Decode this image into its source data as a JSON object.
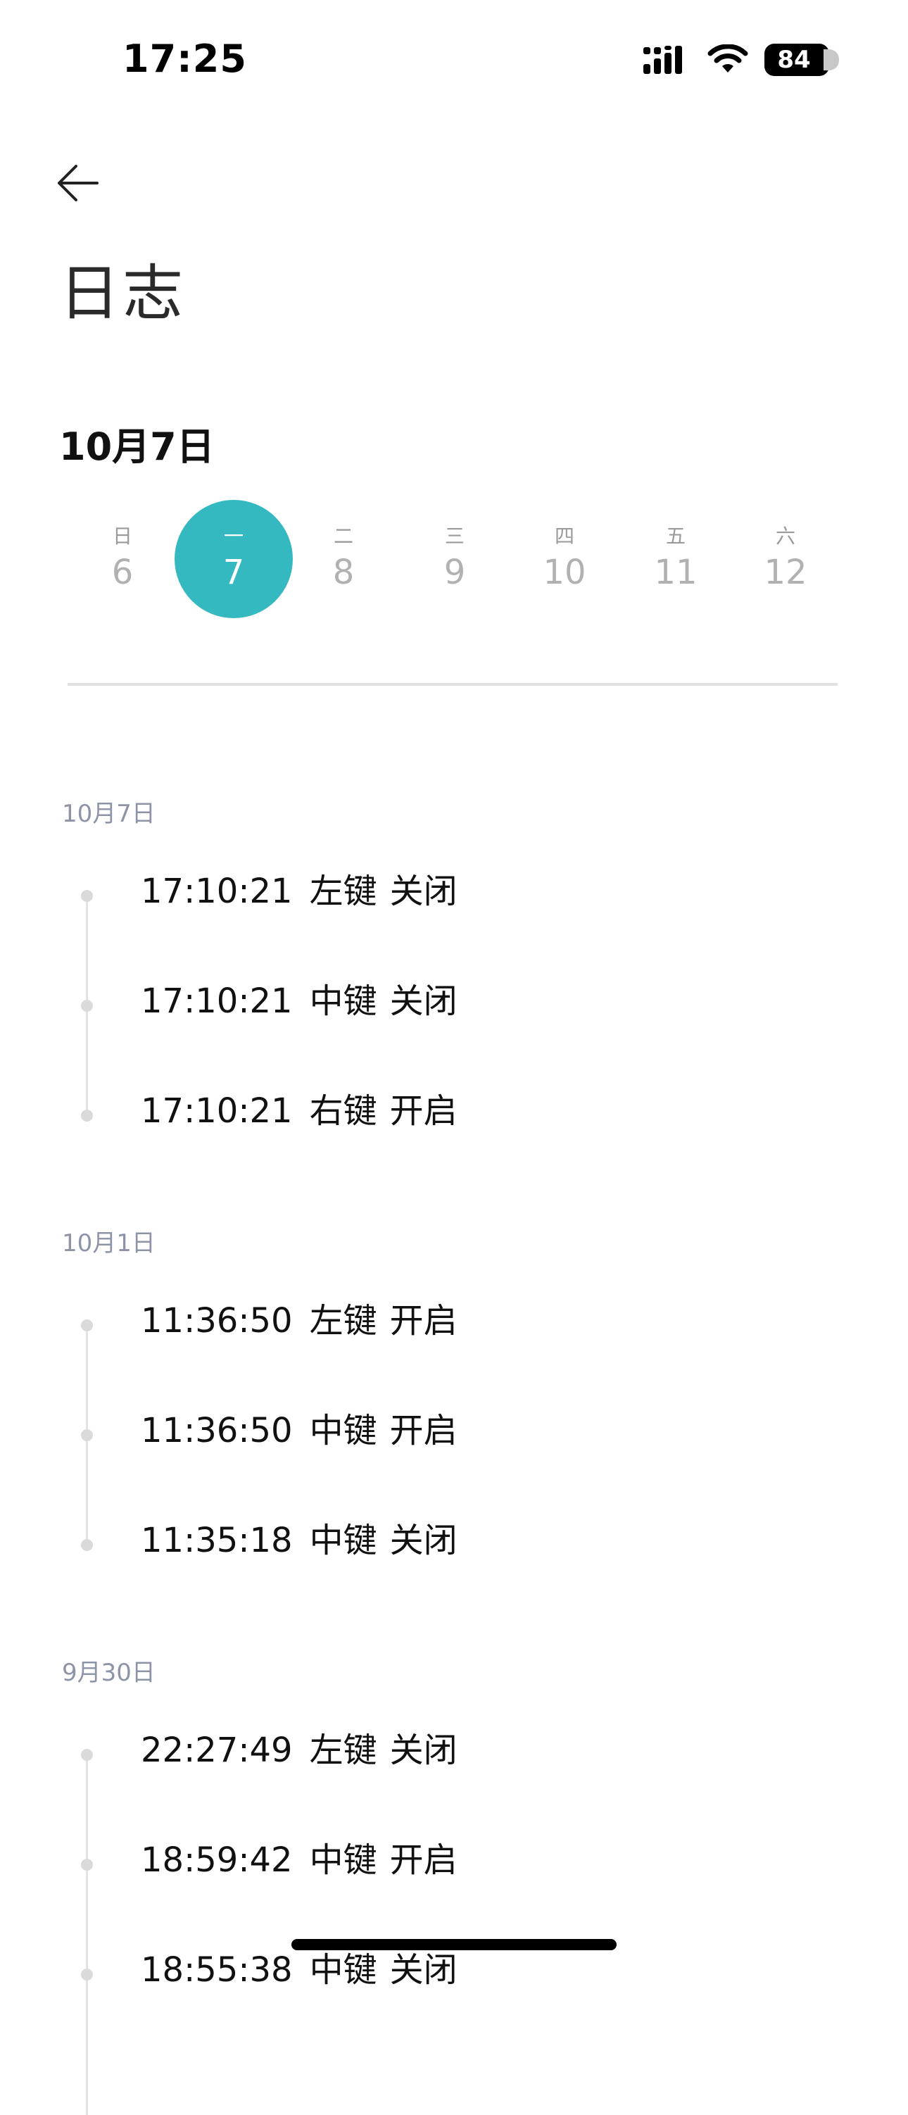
{
  "status_bar": {
    "time": "17:25",
    "battery": "84",
    "icons": [
      "cellular-signal-icon",
      "wifi-icon",
      "battery-icon"
    ]
  },
  "header": {
    "back_icon": "arrow-left-icon",
    "title": "日志",
    "selected_date": "10月7日"
  },
  "week": {
    "accent_color": "#35b9c1",
    "selected_index": 1,
    "days": [
      {
        "weekday": "日",
        "day": "6"
      },
      {
        "weekday": "一",
        "day": "7"
      },
      {
        "weekday": "二",
        "day": "8"
      },
      {
        "weekday": "三",
        "day": "9"
      },
      {
        "weekday": "四",
        "day": "10"
      },
      {
        "weekday": "五",
        "day": "11"
      },
      {
        "weekday": "六",
        "day": "12"
      }
    ]
  },
  "groups": [
    {
      "date": "10月7日",
      "entries": [
        {
          "time": "17:10:21",
          "key": "左键",
          "state": "关闭"
        },
        {
          "time": "17:10:21",
          "key": "中键",
          "state": "关闭"
        },
        {
          "time": "17:10:21",
          "key": "右键",
          "state": "开启"
        }
      ]
    },
    {
      "date": "10月1日",
      "entries": [
        {
          "time": "11:36:50",
          "key": "左键",
          "state": "开启"
        },
        {
          "time": "11:36:50",
          "key": "中键",
          "state": "开启"
        },
        {
          "time": "11:35:18",
          "key": "中键",
          "state": "关闭"
        }
      ]
    },
    {
      "date": "9月30日",
      "entries": [
        {
          "time": "22:27:49",
          "key": "左键",
          "state": "关闭"
        },
        {
          "time": "18:59:42",
          "key": "中键",
          "state": "开启"
        },
        {
          "time": "18:55:38",
          "key": "中键",
          "state": "关闭"
        }
      ]
    }
  ]
}
